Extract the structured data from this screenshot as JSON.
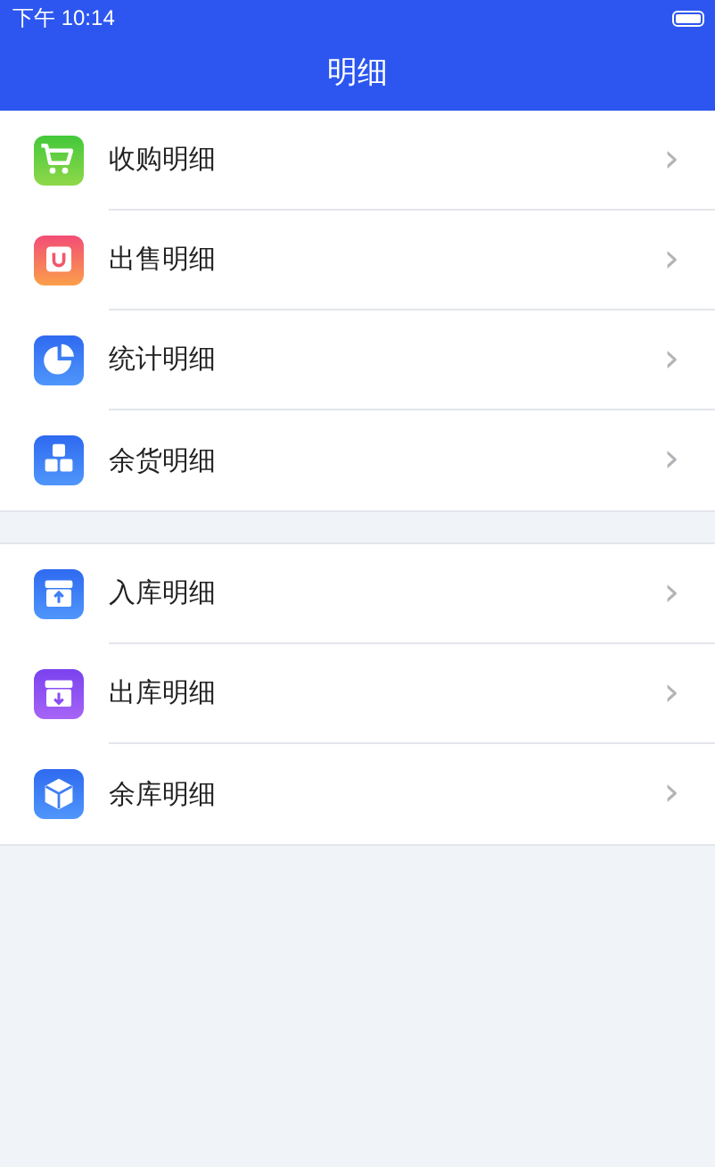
{
  "status_bar": {
    "time": "下午 10:14"
  },
  "header": {
    "title": "明细"
  },
  "groups": [
    {
      "items": [
        {
          "kind": "cart",
          "label": "收购明细",
          "chevron": "›"
        },
        {
          "kind": "bag",
          "label": "出售明细",
          "chevron": "›"
        },
        {
          "kind": "pie",
          "label": "统计明细",
          "chevron": "›"
        },
        {
          "kind": "boxes",
          "label": "余货明细",
          "chevron": "›"
        }
      ]
    },
    {
      "items": [
        {
          "kind": "inbox-in",
          "label": "入库明细",
          "chevron": "›"
        },
        {
          "kind": "inbox-out",
          "label": "出库明细",
          "chevron": "›"
        },
        {
          "kind": "cube",
          "label": "余库明细",
          "chevron": "›"
        }
      ]
    }
  ]
}
